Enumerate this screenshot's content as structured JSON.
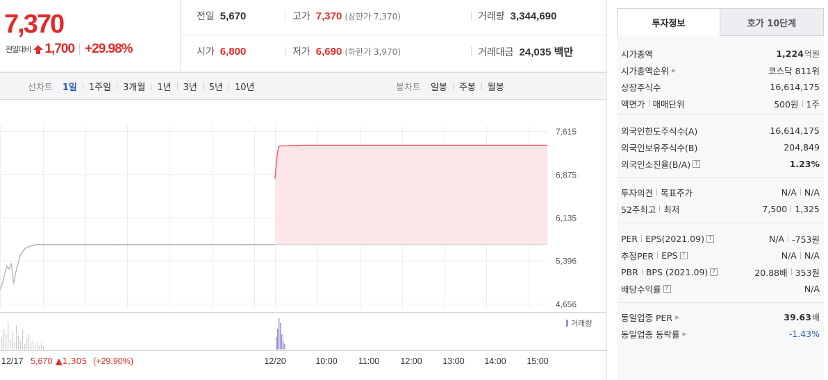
{
  "price": {
    "current": "7,370",
    "change_label": "전일대비",
    "change_amount": "1,700",
    "change_percent": "+29.98%"
  },
  "stats": {
    "prev_close_label": "전일",
    "prev_close": "5,670",
    "high_label": "고가",
    "high": "7,370",
    "upper_limit": "(상한가 7,370)",
    "volume_label": "거래량",
    "volume": "3,344,690",
    "open_label": "시가",
    "open": "6,800",
    "low_label": "저가",
    "low": "6,690",
    "lower_limit": "(하한가 3,970)",
    "amount_label": "거래대금",
    "amount": "24,035 백만"
  },
  "tabs": {
    "line_chart_label": "선차트",
    "line_items": [
      "1일",
      "1주일",
      "3개월",
      "1년",
      "3년",
      "5년",
      "10년"
    ],
    "active_line_item": "1일",
    "candle_chart_label": "봉차트",
    "candle_items": [
      "일봉",
      "주봉",
      "월봉"
    ]
  },
  "chart_data": {
    "type": "area",
    "title": "",
    "y_ticks": [
      "7,615",
      "6,875",
      "6,135",
      "5,396",
      "4,656"
    ],
    "ylim": [
      4656,
      7615
    ],
    "x_ticks": [
      "12/20",
      "10:00",
      "11:00",
      "12:00",
      "13:00",
      "14:00",
      "15:00"
    ],
    "prev_day": {
      "label": "12/17",
      "close": "5,670",
      "change": "▲1,305",
      "change_percent": "(+29.90%)",
      "values": [
        4900,
        5000,
        5150,
        5300,
        5250,
        5350,
        5000,
        5200,
        5350,
        5500,
        5550,
        5600,
        5620,
        5640,
        5650,
        5660,
        5670,
        5670,
        5670,
        5670
      ]
    },
    "today_values": [
      6800,
      7200,
      7340,
      7360,
      7370,
      7370,
      7370,
      7370,
      7370,
      7370,
      7370,
      7370,
      7370,
      7370,
      7370,
      7370
    ],
    "baseline": 5670,
    "volume_legend": "거래량",
    "colors": {
      "up": "#e12b2b",
      "area": "#fde6e8",
      "prev_line": "#b5b8be",
      "volume": "#9b8fd0",
      "volume_prev": "#c9ccd1"
    }
  },
  "info_tabs": [
    "투자정보",
    "호가 10단계"
  ],
  "info": {
    "market_cap_label": "시가총액",
    "market_cap": "1,224",
    "market_cap_unit": "억원",
    "market_cap_rank_label": "시가총액순위",
    "market_cap_rank": "코스닥 811위",
    "listed_shares_label": "상장주식수",
    "listed_shares": "16,614,175",
    "par_label": "액면가",
    "trade_unit_label": "매매단위",
    "par_value": "500원",
    "trade_unit": "1주",
    "foreign_limit_label": "외국인한도주식수(A)",
    "foreign_limit": "16,614,175",
    "foreign_hold_label": "외국인보유주식수(B)",
    "foreign_hold": "204,849",
    "foreign_ratio_label": "외국인소진율(B/A)",
    "foreign_ratio": "1.23%",
    "opinion_label": "투자의견",
    "target_label": "목표주가",
    "opinion": "N/A",
    "target": "N/A",
    "week52_high_label": "52주최고",
    "week52_low_label": "최저",
    "week52_high": "7,500",
    "week52_low": "1,325",
    "per_label": "PER",
    "eps_label": "EPS(2021.09)",
    "per": "N/A",
    "eps": "-753원",
    "est_per_label": "추정PER",
    "est_eps_label": "EPS",
    "est_per": "N/A",
    "est_eps": "N/A",
    "pbr_label": "PBR",
    "bps_label": "BPS (2021.09)",
    "pbr": "20.88배",
    "bps": "353원",
    "dividend_label": "배당수익률",
    "dividend": "N/A",
    "industry_per_label": "동일업종 PER",
    "industry_per": "39.63",
    "industry_per_unit": "배",
    "industry_rate_label": "동일업종 등락률",
    "industry_rate": "-1.43%"
  }
}
